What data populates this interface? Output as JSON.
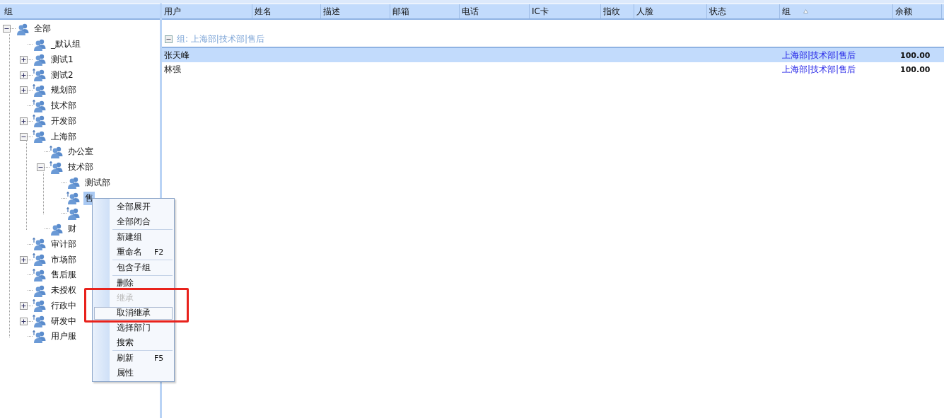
{
  "tree_panel": {
    "header": "组",
    "tree": [
      {
        "label": "全部",
        "kind": "group",
        "expanded": true,
        "selected": false,
        "children": [
          {
            "label": "_默认组",
            "kind": "group",
            "selected": false
          },
          {
            "label": "测试1",
            "kind": "group",
            "expanded": false,
            "selected": false
          },
          {
            "label": "测试2",
            "kind": "inherit",
            "expanded": false,
            "selected": false
          },
          {
            "label": "规划部",
            "kind": "inherit",
            "expanded": false,
            "selected": false
          },
          {
            "label": "技术部",
            "kind": "inherit",
            "selected": false
          },
          {
            "label": "开发部",
            "kind": "inherit",
            "expanded": false,
            "selected": false
          },
          {
            "label": "上海部",
            "kind": "inherit",
            "expanded": true,
            "selected": false,
            "children": [
              {
                "label": "办公室",
                "kind": "inherit",
                "selected": false
              },
              {
                "label": "技术部",
                "kind": "inherit",
                "expanded": true,
                "selected": false,
                "children": [
                  {
                    "label": "测试部",
                    "kind": "group",
                    "selected": false
                  },
                  {
                    "label": "售",
                    "kind": "inherit",
                    "selected": true
                  },
                  {
                    "kind": "inherit",
                    "selected": false
                  }
                ]
              },
              {
                "label": "财",
                "kind": "group",
                "selected": false
              }
            ]
          },
          {
            "label": "审计部",
            "kind": "inherit",
            "selected": false
          },
          {
            "label": "市场部",
            "kind": "inherit",
            "expanded": false,
            "selected": false
          },
          {
            "label": "售后服",
            "kind": "inherit",
            "selected": false
          },
          {
            "label": "未授权",
            "kind": "group",
            "selected": false
          },
          {
            "label": "行政中",
            "kind": "inherit",
            "expanded": false,
            "selected": false
          },
          {
            "label": "研发中",
            "kind": "inherit",
            "expanded": false,
            "selected": false
          },
          {
            "label": "用户服",
            "kind": "inherit",
            "selected": false
          }
        ]
      }
    ]
  },
  "table": {
    "columns": [
      {
        "label": "用户",
        "sorted": false
      },
      {
        "label": "姓名",
        "sorted": false
      },
      {
        "label": "描述",
        "sorted": false
      },
      {
        "label": "邮箱",
        "sorted": false
      },
      {
        "label": "电话",
        "sorted": false
      },
      {
        "label": "IC卡",
        "sorted": false
      },
      {
        "label": "指纹",
        "sorted": false
      },
      {
        "label": "人脸",
        "sorted": false
      },
      {
        "label": "状态",
        "sorted": false
      },
      {
        "label": "组",
        "sorted": true
      },
      {
        "label": "余额",
        "sorted": false
      }
    ],
    "group_header": {
      "label": "组: 上海部|技术部|售后",
      "expanded": true
    },
    "rows": [
      {
        "user": "张天峰",
        "group": "上海部|技术部|售后",
        "balance": "100.00",
        "selected": true
      },
      {
        "user": "林强",
        "group": "上海部|技术部|售后",
        "balance": "100.00",
        "selected": false
      }
    ]
  },
  "context_menu": {
    "sections": [
      [
        {
          "label": "全部展开",
          "disabled": false,
          "hovered": false
        },
        {
          "label": "全部闭合",
          "disabled": false,
          "hovered": false
        }
      ],
      [
        {
          "label": "新建组",
          "disabled": false,
          "hovered": false
        },
        {
          "label": "重命名",
          "shortcut": "F2",
          "disabled": false,
          "hovered": false
        }
      ],
      [
        {
          "label": "包含子组",
          "disabled": false,
          "hovered": false
        }
      ],
      [
        {
          "label": "删除",
          "disabled": false,
          "hovered": false
        },
        {
          "label": "继承",
          "disabled": true,
          "hovered": false
        },
        {
          "label": "取消继承",
          "disabled": false,
          "hovered": true
        },
        {
          "label": "选择部门",
          "disabled": false,
          "hovered": false
        },
        {
          "label": "搜索",
          "disabled": false,
          "hovered": false
        }
      ],
      [
        {
          "label": "刷新",
          "shortcut": "F5",
          "disabled": false,
          "hovered": false
        },
        {
          "label": "属性",
          "disabled": false,
          "hovered": false
        }
      ]
    ]
  },
  "annotation": {
    "kind": "highlight_box"
  }
}
